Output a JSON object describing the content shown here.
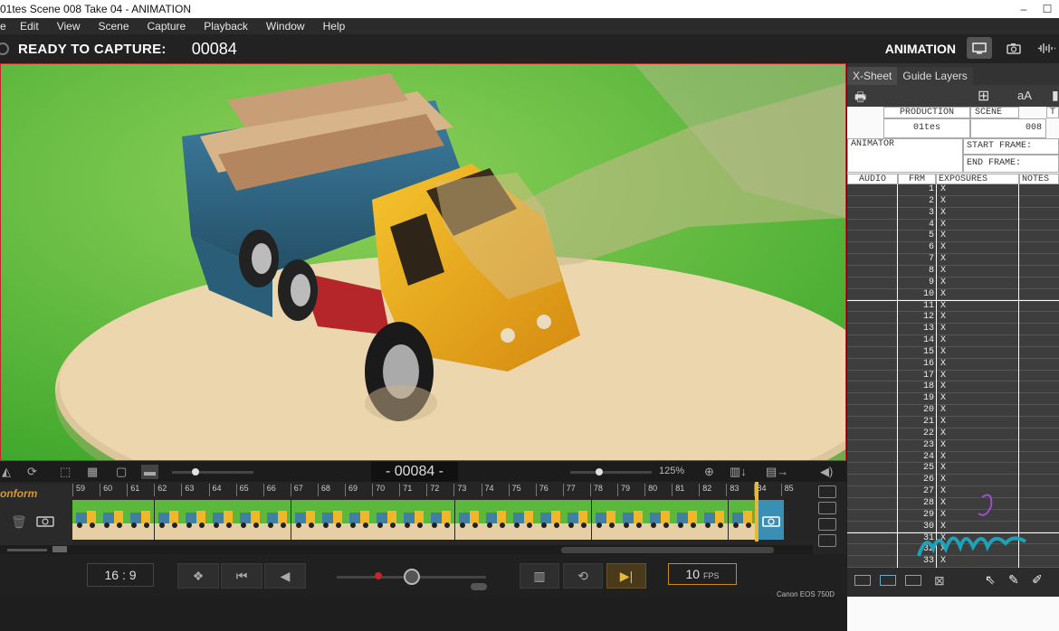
{
  "window": {
    "title": "01tes  Scene 008  Take 04 - ANIMATION",
    "min": "–",
    "max": "☐"
  },
  "menu": [
    "e",
    "Edit",
    "View",
    "Scene",
    "Capture",
    "Playback",
    "Window",
    "Help"
  ],
  "capture": {
    "status": "READY TO CAPTURE:",
    "frame": "00084",
    "mode": "ANIMATION"
  },
  "viewer_toolbar": {
    "frame_counter": "- 00084 -",
    "zoom": "125%"
  },
  "timeline": {
    "conform_label": "onform",
    "frames": [
      "59",
      "60",
      "61",
      "62",
      "63",
      "64",
      "65",
      "66",
      "67",
      "68",
      "69",
      "70",
      "71",
      "72",
      "73",
      "74",
      "75",
      "76",
      "77",
      "78",
      "79",
      "80",
      "81",
      "82",
      "83",
      "84",
      "85"
    ]
  },
  "transport": {
    "ratio": "16 : 9",
    "fps_value": "10",
    "fps_unit": "FPS",
    "camera": "Canon EOS 750D"
  },
  "xsheet": {
    "tabs": [
      "X-Sheet",
      "Guide Layers"
    ],
    "headers": {
      "production": "PRODUCTION",
      "scene": "SCENE",
      "t": "T",
      "production_val": "01tes",
      "scene_val": "008",
      "animator": "ANIMATOR",
      "start_frame": "START FRAME:",
      "end_frame": "END FRAME:"
    },
    "columns": [
      "AUDIO",
      "FRM",
      "EXPOSURES",
      "NOTES"
    ],
    "rows": [
      "1",
      "2",
      "3",
      "4",
      "5",
      "6",
      "7",
      "8",
      "9",
      "10",
      "11",
      "12",
      "13",
      "14",
      "15",
      "16",
      "17",
      "18",
      "19",
      "20",
      "21",
      "22",
      "23",
      "24",
      "25",
      "26",
      "27",
      "28",
      "29",
      "30",
      "31",
      "32",
      "33"
    ],
    "exposure_mark": "X"
  },
  "colors": {
    "accent": "#c78b1e",
    "record_border": "#c0262c",
    "capture_slot": "#3a8fb5"
  }
}
